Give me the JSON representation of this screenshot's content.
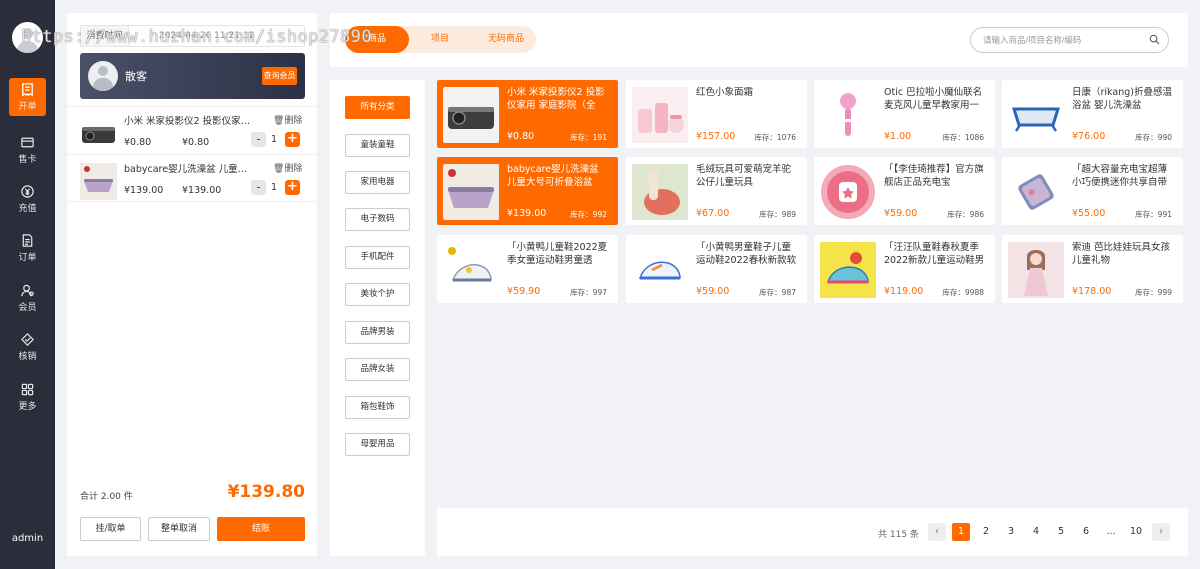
{
  "watermark": "https://www.huzhan.com/ishop27890",
  "sidebar": {
    "items": [
      {
        "label": "开单",
        "icon": "receipt-icon"
      },
      {
        "label": "售卡",
        "icon": "card-icon"
      },
      {
        "label": "充值",
        "icon": "recharge-icon"
      },
      {
        "label": "订单",
        "icon": "order-icon"
      },
      {
        "label": "会员",
        "icon": "member-icon"
      },
      {
        "label": "核销",
        "icon": "verify-icon"
      },
      {
        "label": "更多",
        "icon": "grid-icon"
      }
    ],
    "user": "admin"
  },
  "cart": {
    "time_label": "消费时间",
    "time_value": "2024-04-26 11:21:12",
    "member_name": "散客",
    "member_button": "查询会员",
    "items": [
      {
        "name": "小米 米家投影仪2 投影仪家用 家庭影院（全向…",
        "delete": "删除",
        "price": "¥0.80",
        "subtotal": "¥0.80",
        "qty": "1",
        "minus": "-",
        "plus": "+"
      },
      {
        "name": "babycare婴儿洗澡盆 儿童大号可折叠浴盆",
        "delete": "删除",
        "price": "¥139.00",
        "subtotal": "¥139.00",
        "qty": "1",
        "minus": "-",
        "plus": "+"
      }
    ],
    "total_label": "合计 2.00 件",
    "total_amount": "¥139.80",
    "buttons": {
      "hold": "挂/取单",
      "cancel": "整单取消",
      "checkout": "结账"
    }
  },
  "tabs": [
    "商品",
    "项目",
    "无码商品"
  ],
  "search": {
    "placeholder": "请输入商品/项目名称/编码"
  },
  "categories": [
    "所有分类",
    "童装童鞋",
    "家用电器",
    "电子数码",
    "手机配件",
    "美妆个护",
    "品牌男装",
    "品牌女装",
    "箱包鞋饰",
    "母婴用品"
  ],
  "products": [
    {
      "name": "小米 米家投影仪2 投影仪家用 家庭影院（全向…",
      "price": "¥0.80",
      "stock": "库存：191",
      "selected": true
    },
    {
      "name": "红色小象面霜",
      "price": "¥157.00",
      "stock": "库存：1076"
    },
    {
      "name": "Otic 巴拉啦小魔仙联名麦克风儿童早教家用一体…",
      "price": "¥1.00",
      "stock": "库存：1086"
    },
    {
      "name": "日康（rikang)折叠感温浴盆 婴儿洗澡盆",
      "price": "¥76.00",
      "stock": "库存：990"
    },
    {
      "name": "babycare婴儿洗澡盆 儿童大号可折叠浴盆",
      "price": "¥139.00",
      "stock": "库存：992",
      "selected": true
    },
    {
      "name": "毛绒玩具可爱萌宠羊驼公仔儿童玩具",
      "price": "¥67.00",
      "stock": "库存：989"
    },
    {
      "name": "「【李佳琦推荐】官方旗舰店正品充电宝20000…",
      "price": "¥59.00",
      "stock": "库存：986"
    },
    {
      "name": "「超大容量充电宝超薄小巧便携迷你共享自带线…",
      "price": "¥55.00",
      "stock": "库存：991"
    },
    {
      "name": "「小黄鸭儿童鞋2022夏季女童运动鞋男童透气…",
      "price": "¥59.90",
      "stock": "库存：997"
    },
    {
      "name": "「小黄鸭男童鞋子儿童运动鞋2022春秋新款软底…",
      "price": "¥59.00",
      "stock": "库存：987"
    },
    {
      "name": "「汪汪队童鞋春秋夏季2022新款儿童运动鞋男小…",
      "price": "¥119.00",
      "stock": "库存：9988"
    },
    {
      "name": "索迪 芭比娃娃玩具女孩儿童礼物",
      "price": "¥178.00",
      "stock": "库存：999"
    }
  ],
  "pagination": {
    "total": "共 115 条",
    "prev": "‹",
    "pages": [
      "1",
      "2",
      "3",
      "4",
      "5",
      "6",
      "...",
      "10"
    ],
    "current": "1",
    "next": "›"
  },
  "colors": {
    "accent": "#ff6a00",
    "sidebar_bg": "#2b2d3a",
    "page_bg": "#f1f2f5"
  }
}
